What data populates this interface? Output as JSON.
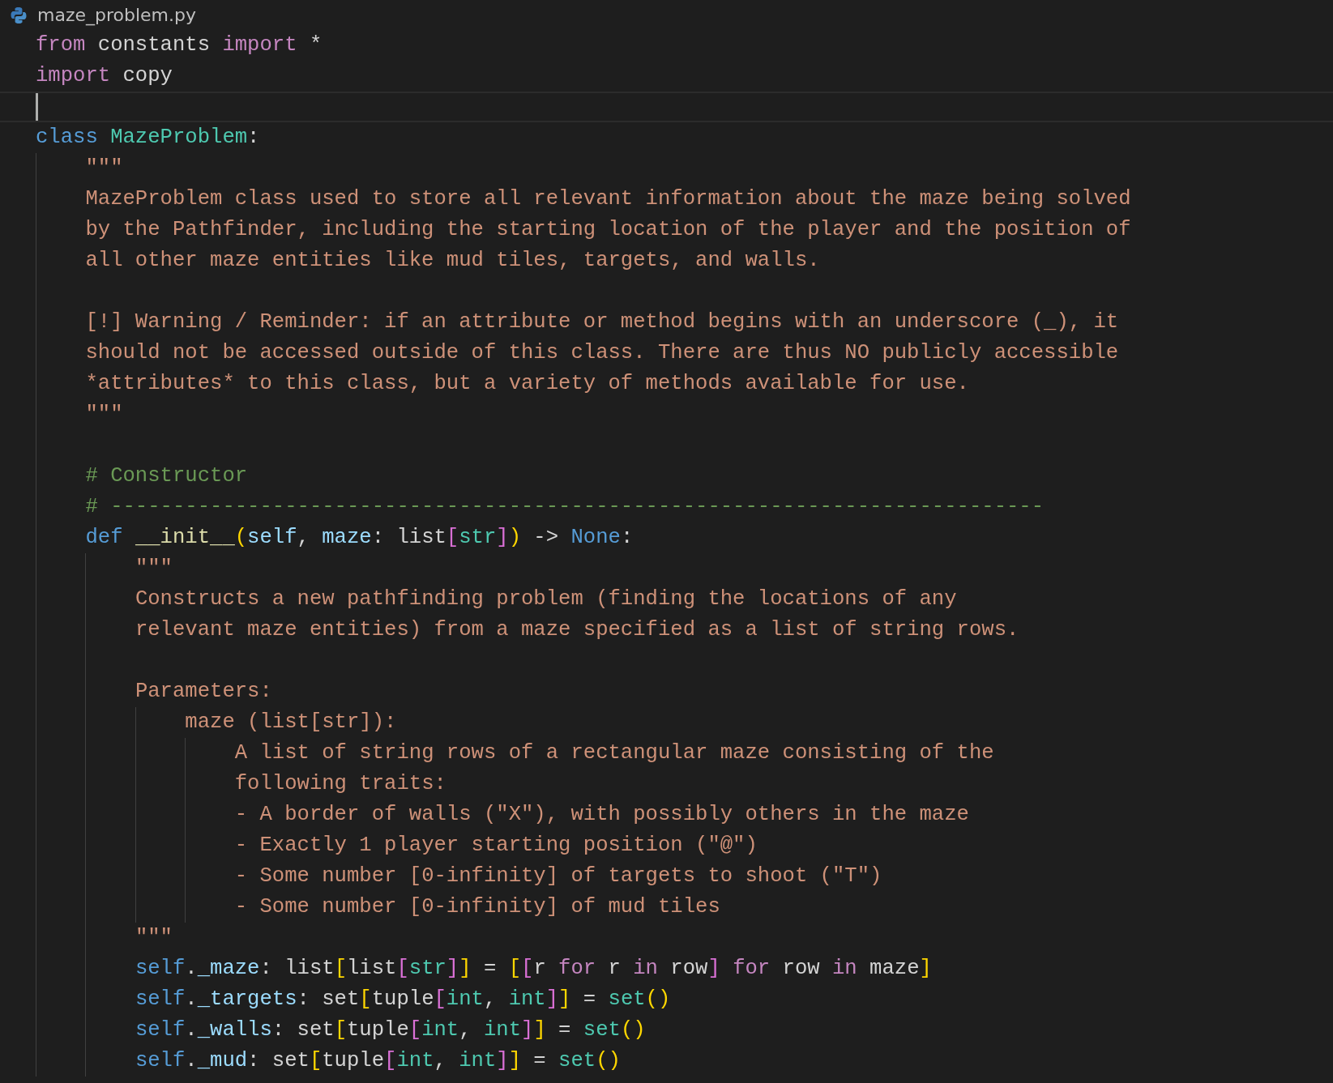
{
  "tab": {
    "title": "maze_problem.py"
  },
  "lines": [
    {
      "current": false,
      "tokens": [
        {
          "kind": "kw",
          "text": "from"
        },
        {
          "kind": "plain",
          "text": " constants "
        },
        {
          "kind": "kw",
          "text": "import"
        },
        {
          "kind": "plain",
          "text": " *"
        }
      ]
    },
    {
      "current": false,
      "tokens": [
        {
          "kind": "kw",
          "text": "import"
        },
        {
          "kind": "plain",
          "text": " copy"
        }
      ]
    },
    {
      "current": true
    },
    {
      "current": false,
      "tokens": [
        {
          "kind": "storage",
          "text": "class "
        },
        {
          "kind": "type",
          "text": "MazeProblem"
        },
        {
          "kind": "plain",
          "text": ":"
        }
      ],
      "children": [
        {
          "current": false,
          "tokens": [
            {
              "kind": "str",
              "text": "\"\"\""
            }
          ]
        },
        {
          "current": false,
          "tokens": [
            {
              "kind": "str",
              "text": "MazeProblem class used to store all relevant information about the maze being solved"
            }
          ]
        },
        {
          "current": false,
          "tokens": [
            {
              "kind": "str",
              "text": "by the Pathfinder, including the starting location of the player and the position of"
            }
          ]
        },
        {
          "current": false,
          "tokens": [
            {
              "kind": "str",
              "text": "all other maze entities like mud tiles, targets, and walls."
            }
          ]
        },
        {
          "current": false
        },
        {
          "current": false,
          "tokens": [
            {
              "kind": "str",
              "text": "[!] Warning / Reminder: if an attribute or method begins with an underscore (_), it"
            }
          ]
        },
        {
          "current": false,
          "tokens": [
            {
              "kind": "str",
              "text": "should not be accessed outside of this class. There are thus NO publicly accessible"
            }
          ]
        },
        {
          "current": false,
          "tokens": [
            {
              "kind": "str",
              "text": "*attributes* to this class, but a variety of methods available for use."
            }
          ]
        },
        {
          "current": false,
          "tokens": [
            {
              "kind": "str",
              "text": "\"\"\""
            }
          ]
        },
        {
          "current": false
        },
        {
          "current": false,
          "tokens": [
            {
              "kind": "comment",
              "text": "# Constructor"
            }
          ]
        },
        {
          "current": false,
          "tokens": [
            {
              "kind": "comment",
              "text": "# ---------------------------------------------------------------------------"
            }
          ]
        },
        {
          "current": false,
          "tokens": [
            {
              "kind": "storage",
              "text": "def "
            },
            {
              "kind": "func",
              "text": "__init__"
            },
            {
              "kind": "b1",
              "text": "("
            },
            {
              "kind": "var",
              "text": "self"
            },
            {
              "kind": "plain",
              "text": ", "
            },
            {
              "kind": "var",
              "text": "maze"
            },
            {
              "kind": "plain",
              "text": ": list"
            },
            {
              "kind": "b2",
              "text": "["
            },
            {
              "kind": "type",
              "text": "str"
            },
            {
              "kind": "b2",
              "text": "]"
            },
            {
              "kind": "b1",
              "text": ")"
            },
            {
              "kind": "plain",
              "text": " -> "
            },
            {
              "kind": "storage",
              "text": "None"
            },
            {
              "kind": "plain",
              "text": ":"
            }
          ],
          "children": [
            {
              "current": false,
              "tokens": [
                {
                  "kind": "str",
                  "text": "\"\"\""
                }
              ]
            },
            {
              "current": false,
              "tokens": [
                {
                  "kind": "str",
                  "text": "Constructs a new pathfinding problem (finding the locations of any"
                }
              ]
            },
            {
              "current": false,
              "tokens": [
                {
                  "kind": "str",
                  "text": "relevant maze entities) from a maze specified as a list of string rows."
                }
              ]
            },
            {
              "current": false
            },
            {
              "current": false,
              "tokens": [
                {
                  "kind": "str",
                  "text": "Parameters:"
                }
              ],
              "children": [
                {
                  "current": false,
                  "tokens": [
                    {
                      "kind": "str",
                      "text": "maze (list[str]):"
                    }
                  ],
                  "children": [
                    {
                      "current": false,
                      "tokens": [
                        {
                          "kind": "str",
                          "text": "A list of string rows of a rectangular maze consisting of the"
                        }
                      ]
                    },
                    {
                      "current": false,
                      "tokens": [
                        {
                          "kind": "str",
                          "text": "following traits:"
                        }
                      ]
                    },
                    {
                      "current": false,
                      "tokens": [
                        {
                          "kind": "str",
                          "text": "- A border of walls (\"X\"), with possibly others in the maze"
                        }
                      ]
                    },
                    {
                      "current": false,
                      "tokens": [
                        {
                          "kind": "str",
                          "text": "- Exactly 1 player starting position (\"@\")"
                        }
                      ]
                    },
                    {
                      "current": false,
                      "tokens": [
                        {
                          "kind": "str",
                          "text": "- Some number [0-infinity] of targets to shoot (\"T\")"
                        }
                      ]
                    },
                    {
                      "current": false,
                      "tokens": [
                        {
                          "kind": "str",
                          "text": "- Some number [0-infinity] of mud tiles"
                        }
                      ]
                    }
                  ]
                }
              ]
            },
            {
              "current": false,
              "tokens": [
                {
                  "kind": "str",
                  "text": "\"\"\""
                }
              ]
            },
            {
              "current": false,
              "tokens": [
                {
                  "kind": "storage",
                  "text": "self"
                },
                {
                  "kind": "plain",
                  "text": "."
                },
                {
                  "kind": "var",
                  "text": "_maze"
                },
                {
                  "kind": "plain",
                  "text": ": list"
                },
                {
                  "kind": "b1",
                  "text": "["
                },
                {
                  "kind": "plain",
                  "text": "list"
                },
                {
                  "kind": "b2",
                  "text": "["
                },
                {
                  "kind": "type",
                  "text": "str"
                },
                {
                  "kind": "b2",
                  "text": "]"
                },
                {
                  "kind": "b1",
                  "text": "]"
                },
                {
                  "kind": "plain",
                  "text": " = "
                },
                {
                  "kind": "b1",
                  "text": "["
                },
                {
                  "kind": "b2",
                  "text": "["
                },
                {
                  "kind": "plain",
                  "text": "r "
                },
                {
                  "kind": "kw",
                  "text": "for"
                },
                {
                  "kind": "plain",
                  "text": " r "
                },
                {
                  "kind": "kw",
                  "text": "in"
                },
                {
                  "kind": "plain",
                  "text": " row"
                },
                {
                  "kind": "b2",
                  "text": "] "
                },
                {
                  "kind": "kw",
                  "text": "for"
                },
                {
                  "kind": "plain",
                  "text": " row "
                },
                {
                  "kind": "kw",
                  "text": "in"
                },
                {
                  "kind": "plain",
                  "text": " maze"
                },
                {
                  "kind": "b1",
                  "text": "]"
                }
              ]
            },
            {
              "current": false,
              "tokens": [
                {
                  "kind": "storage",
                  "text": "self"
                },
                {
                  "kind": "plain",
                  "text": "."
                },
                {
                  "kind": "var",
                  "text": "_targets"
                },
                {
                  "kind": "plain",
                  "text": ": set"
                },
                {
                  "kind": "b1",
                  "text": "["
                },
                {
                  "kind": "plain",
                  "text": "tuple"
                },
                {
                  "kind": "b2",
                  "text": "["
                },
                {
                  "kind": "type",
                  "text": "int"
                },
                {
                  "kind": "plain",
                  "text": ", "
                },
                {
                  "kind": "type",
                  "text": "int"
                },
                {
                  "kind": "b2",
                  "text": "]"
                },
                {
                  "kind": "b1",
                  "text": "]"
                },
                {
                  "kind": "plain",
                  "text": " = "
                },
                {
                  "kind": "type",
                  "text": "set"
                },
                {
                  "kind": "b1",
                  "text": "()"
                }
              ]
            },
            {
              "current": false,
              "tokens": [
                {
                  "kind": "storage",
                  "text": "self"
                },
                {
                  "kind": "plain",
                  "text": "."
                },
                {
                  "kind": "var",
                  "text": "_walls"
                },
                {
                  "kind": "plain",
                  "text": ": set"
                },
                {
                  "kind": "b1",
                  "text": "["
                },
                {
                  "kind": "plain",
                  "text": "tuple"
                },
                {
                  "kind": "b2",
                  "text": "["
                },
                {
                  "kind": "type",
                  "text": "int"
                },
                {
                  "kind": "plain",
                  "text": ", "
                },
                {
                  "kind": "type",
                  "text": "int"
                },
                {
                  "kind": "b2",
                  "text": "]"
                },
                {
                  "kind": "b1",
                  "text": "]"
                },
                {
                  "kind": "plain",
                  "text": " = "
                },
                {
                  "kind": "type",
                  "text": "set"
                },
                {
                  "kind": "b1",
                  "text": "()"
                }
              ]
            },
            {
              "current": false,
              "tokens": [
                {
                  "kind": "storage",
                  "text": "self"
                },
                {
                  "kind": "plain",
                  "text": "."
                },
                {
                  "kind": "var",
                  "text": "_mud"
                },
                {
                  "kind": "plain",
                  "text": ": set"
                },
                {
                  "kind": "b1",
                  "text": "["
                },
                {
                  "kind": "plain",
                  "text": "tuple"
                },
                {
                  "kind": "b2",
                  "text": "["
                },
                {
                  "kind": "type",
                  "text": "int"
                },
                {
                  "kind": "plain",
                  "text": ", "
                },
                {
                  "kind": "type",
                  "text": "int"
                },
                {
                  "kind": "b2",
                  "text": "]"
                },
                {
                  "kind": "b1",
                  "text": "]"
                },
                {
                  "kind": "plain",
                  "text": " = "
                },
                {
                  "kind": "type",
                  "text": "set"
                },
                {
                  "kind": "b1",
                  "text": "()"
                }
              ]
            }
          ]
        }
      ]
    }
  ]
}
